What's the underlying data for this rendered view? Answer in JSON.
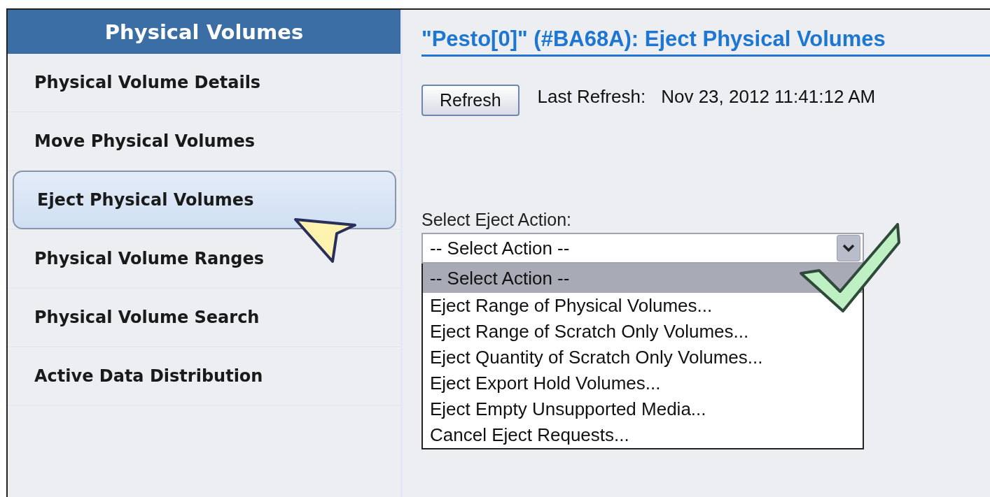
{
  "sidebar": {
    "title": "Physical Volumes",
    "items": [
      {
        "label": "Physical Volume Details",
        "selected": false
      },
      {
        "label": "Move Physical Volumes",
        "selected": false
      },
      {
        "label": "Eject Physical Volumes",
        "selected": true
      },
      {
        "label": "Physical Volume Ranges",
        "selected": false
      },
      {
        "label": "Physical Volume Search",
        "selected": false
      },
      {
        "label": "Active Data Distribution",
        "selected": false
      }
    ]
  },
  "main": {
    "title": "\"Pesto[0]\" (#BA68A): Eject Physical Volumes",
    "refresh_button": "Refresh",
    "last_refresh_label": "Last Refresh:",
    "last_refresh_value": "Nov 23, 2012 11:41:12 AM",
    "select_label": "Select Eject Action:",
    "select_value": "-- Select Action --",
    "expanded": true,
    "options": [
      {
        "label": "-- Select Action --",
        "selected": true
      },
      {
        "label": "Eject Range of Physical Volumes...",
        "selected": false
      },
      {
        "label": "Eject Range of Scratch Only Volumes...",
        "selected": false
      },
      {
        "label": "Eject Quantity of Scratch Only Volumes...",
        "selected": false
      },
      {
        "label": "Eject Export Hold Volumes...",
        "selected": false
      },
      {
        "label": "Eject Empty Unsupported Media...",
        "selected": false
      },
      {
        "label": "Cancel Eject Requests...",
        "selected": false
      }
    ]
  }
}
